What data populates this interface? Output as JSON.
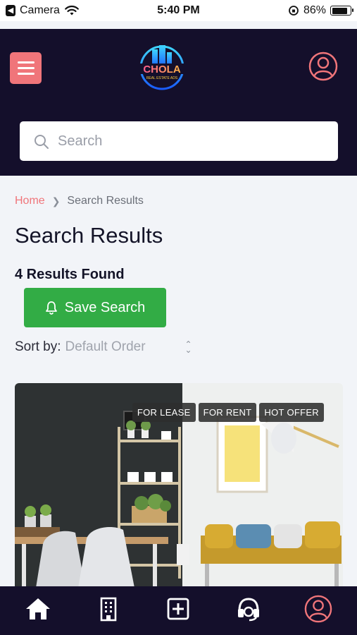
{
  "status_bar": {
    "back_app": "Camera",
    "time": "5:40 PM",
    "battery": "86%",
    "battery_level": 0.86
  },
  "header": {
    "logo_text": "CHOLA",
    "logo_subtext": "REAL ESTATE ADS",
    "search_placeholder": "Search"
  },
  "breadcrumb": {
    "home": "Home",
    "current": "Search Results"
  },
  "page_title": "Search Results",
  "results_count": "4 Results Found",
  "save_search_label": "Save Search",
  "sort": {
    "label": "Sort by:",
    "value": "Default Order"
  },
  "listing": {
    "badges": [
      "FOR LEASE",
      "FOR RENT",
      "HOT OFFER"
    ]
  },
  "bottom_nav": [
    "home-icon",
    "building-icon",
    "add-icon",
    "support-icon",
    "profile-icon"
  ],
  "colors": {
    "header_bg": "#140f2b",
    "accent": "#f0757a",
    "save_green": "#32ac45"
  }
}
